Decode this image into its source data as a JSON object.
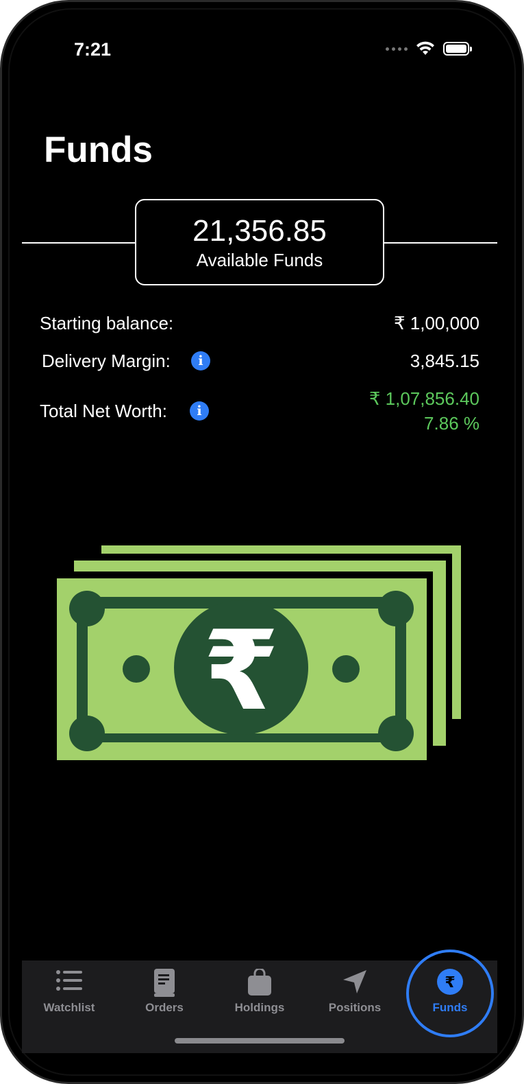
{
  "status_bar": {
    "time": "7:21"
  },
  "page_title": "Funds",
  "available": {
    "amount": "21,356.85",
    "label": "Available Funds"
  },
  "rows": {
    "starting_balance": {
      "label": "Starting balance:",
      "value": "₹ 1,00,000"
    },
    "delivery_margin": {
      "label": "Delivery Margin:",
      "value": "3,845.15",
      "info_icon": "info-icon"
    },
    "net_worth": {
      "label": "Total Net Worth:",
      "value": "₹ 1,07,856.40",
      "percent": "7.86 %",
      "info_icon": "info-icon"
    }
  },
  "illustration": {
    "name": "rupee-banknotes-illustration",
    "symbol": "₹"
  },
  "tabs": [
    {
      "label": "Watchlist",
      "icon": "list-icon",
      "active": false
    },
    {
      "label": "Orders",
      "icon": "book-icon",
      "active": false
    },
    {
      "label": "Holdings",
      "icon": "bag-icon",
      "active": false
    },
    {
      "label": "Positions",
      "icon": "location-arrow-icon",
      "active": false
    },
    {
      "label": "Funds",
      "icon": "rupee-circle-icon",
      "active": true
    }
  ],
  "colors": {
    "accent": "#2f7df6",
    "positive": "#5cc85c",
    "note_light": "#a3d16b",
    "note_dark": "#245233",
    "tabbar_bg": "#1c1c1e",
    "inactive_tab": "#8e8e93"
  }
}
